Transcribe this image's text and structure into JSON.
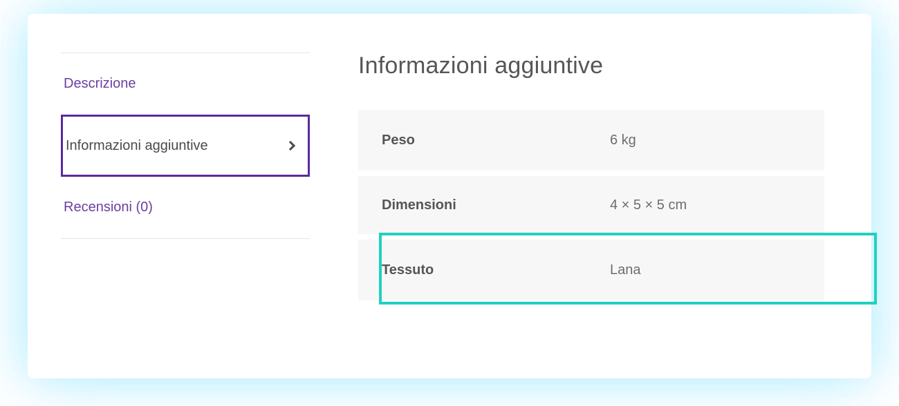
{
  "tabs": {
    "description": "Descrizione",
    "additional_info": "Informazioni aggiuntive",
    "reviews": "Recensioni (0)"
  },
  "panel": {
    "heading": "Informazioni aggiuntive",
    "rows": [
      {
        "key": "Peso",
        "val": "6 kg"
      },
      {
        "key": "Dimensioni",
        "val": "4 × 5 × 5 cm"
      },
      {
        "key": "Tessuto",
        "val": "Lana"
      }
    ]
  },
  "colors": {
    "accent_purple": "#5b2a9d",
    "tab_text": "#6a3fa0",
    "highlight_teal": "#1fd1c1"
  }
}
